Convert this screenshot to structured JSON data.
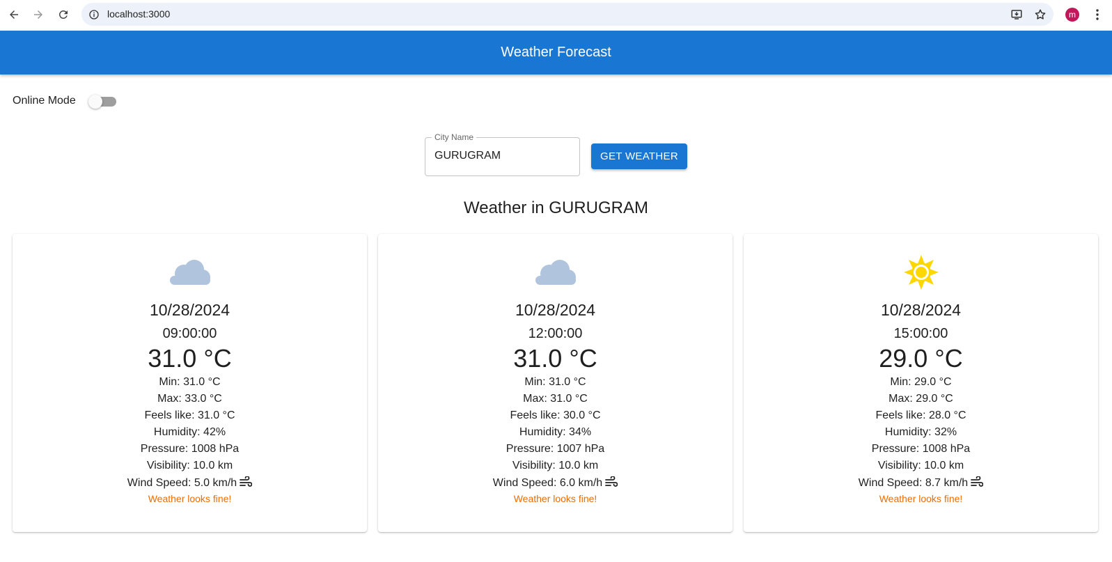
{
  "browser": {
    "url": "localhost:3000",
    "profile_initial": "m",
    "profile_color": "#c2185b"
  },
  "app": {
    "title": "Weather Forecast",
    "accent": "#1976d2"
  },
  "controls": {
    "mode_label": "Online Mode",
    "mode_on": false,
    "city_label": "City Name",
    "city_value": "GURUGRAM",
    "button_label": "GET WEATHER"
  },
  "heading": "Weather in GURUGRAM",
  "forecasts": [
    {
      "icon": "cloud-icon",
      "date": "10/28/2024",
      "time": "09:00:00",
      "temp": "31.0 °C",
      "min": "Min: 31.0 °C",
      "max": "Max: 33.0 °C",
      "feels": "Feels like: 31.0 °C",
      "humidity": "Humidity: 42%",
      "pressure": "Pressure: 1008 hPa",
      "visibility": "Visibility: 10.0 km",
      "wind": "Wind Speed: 5.0 km/h",
      "note": "Weather looks fine!"
    },
    {
      "icon": "cloud-icon",
      "date": "10/28/2024",
      "time": "12:00:00",
      "temp": "31.0 °C",
      "min": "Min: 31.0 °C",
      "max": "Max: 31.0 °C",
      "feels": "Feels like: 30.0 °C",
      "humidity": "Humidity: 34%",
      "pressure": "Pressure: 1007 hPa",
      "visibility": "Visibility: 10.0 km",
      "wind": "Wind Speed: 6.0 km/h",
      "note": "Weather looks fine!"
    },
    {
      "icon": "sun-icon",
      "date": "10/28/2024",
      "time": "15:00:00",
      "temp": "29.0 °C",
      "min": "Min: 29.0 °C",
      "max": "Max: 29.0 °C",
      "feels": "Feels like: 28.0 °C",
      "humidity": "Humidity: 32%",
      "pressure": "Pressure: 1008 hPa",
      "visibility": "Visibility: 10.0 km",
      "wind": "Wind Speed: 8.7 km/h",
      "note": "Weather looks fine!"
    }
  ],
  "colors": {
    "cloud": "#b0c4de",
    "sun": "#ffd700",
    "note": "#ed6c02"
  }
}
